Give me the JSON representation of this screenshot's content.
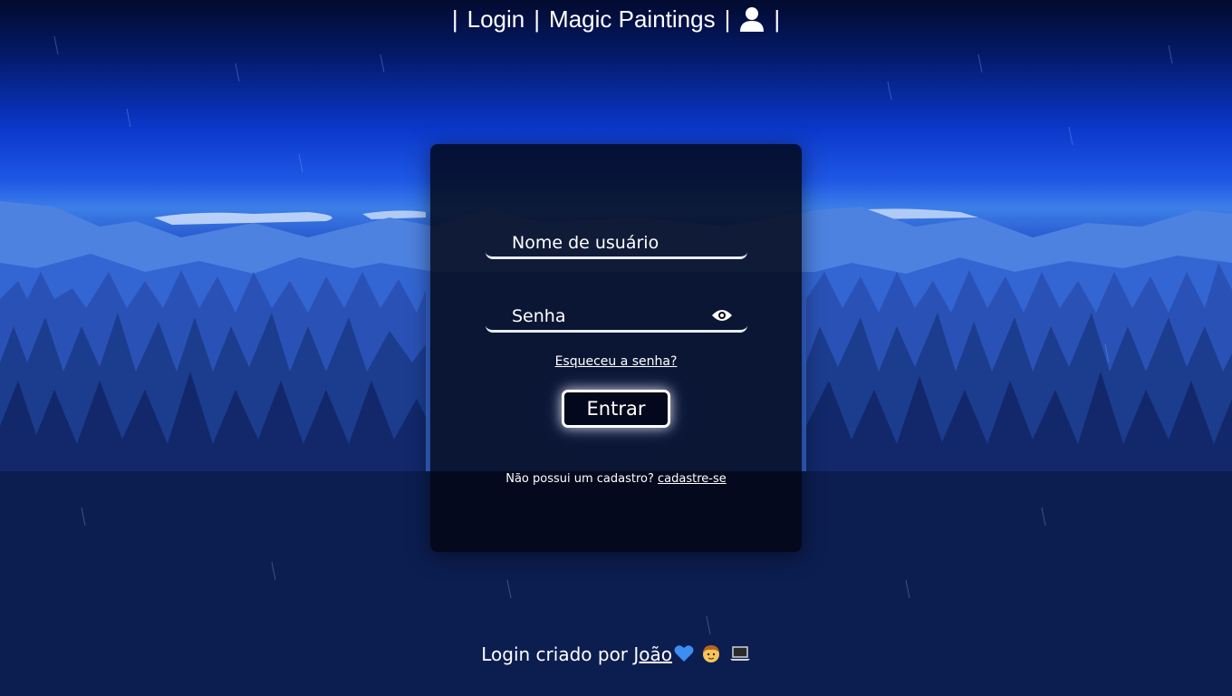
{
  "header": {
    "separator": "|",
    "login_link": "Login",
    "brand_link": "Magic Paintings",
    "user_icon": "user-icon"
  },
  "login_form": {
    "username_placeholder": "Nome de usuário",
    "password_placeholder": "Senha",
    "eye_icon": "eye-icon",
    "forgot_link": "Esqueceu a senha?",
    "submit_label": "Entrar",
    "signup_prompt": "Não possui um cadastro?",
    "signup_link": "cadastre-se"
  },
  "footer": {
    "credit_text": "Login criado por",
    "author_link": "João",
    "emojis": [
      "blue-heart-icon",
      "boy-icon",
      "laptop-icon"
    ]
  },
  "colors": {
    "sky_top": "#020a2e",
    "sky_mid": "#0a36c8",
    "card_bg": "#020512",
    "text": "#ffffff"
  }
}
